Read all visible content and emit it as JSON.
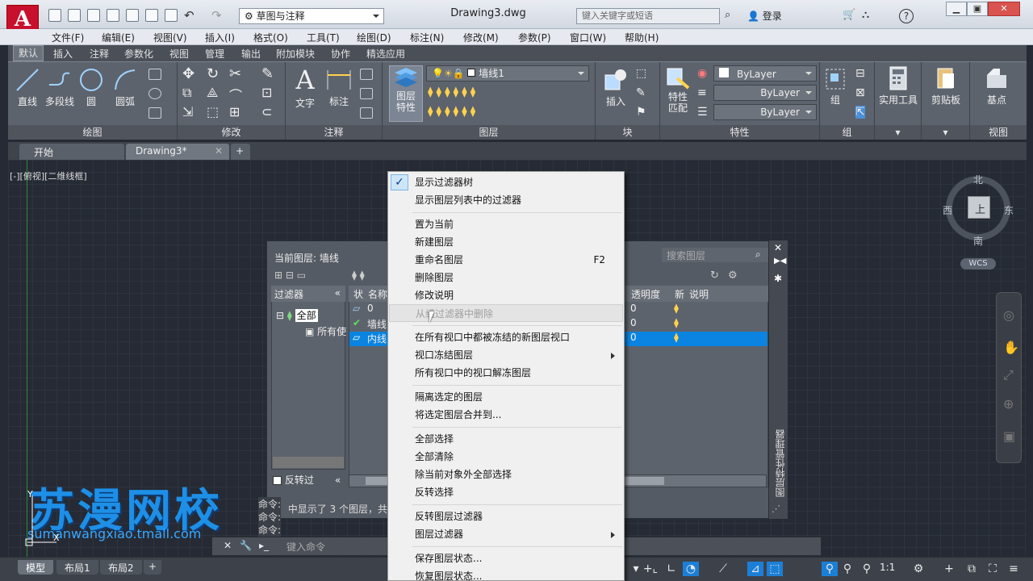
{
  "window": {
    "doc_title": "Drawing3.dwg",
    "workspace": "草图与注释",
    "search_placeholder": "键入关键字或短语",
    "sign_in": "登录"
  },
  "menubar": [
    "文件(F)",
    "编辑(E)",
    "视图(V)",
    "插入(I)",
    "格式(O)",
    "工具(T)",
    "绘图(D)",
    "标注(N)",
    "修改(M)",
    "参数(P)",
    "窗口(W)",
    "帮助(H)"
  ],
  "ribbon_tabs": [
    "默认",
    "插入",
    "注释",
    "参数化",
    "视图",
    "管理",
    "输出",
    "附加模块",
    "协作",
    "精选应用"
  ],
  "ribbon": {
    "draw": {
      "title": "绘图",
      "line": "直线",
      "polyline": "多段线",
      "circle": "圆",
      "arc": "圆弧"
    },
    "modify": {
      "title": "修改"
    },
    "annotation": {
      "title": "注释",
      "text": "文字",
      "dimension": "标注"
    },
    "layers": {
      "title": "图层",
      "properties_line1": "图层",
      "properties_line2": "特性",
      "current_layer": "墙线1"
    },
    "block": {
      "title": "块",
      "insert": "插入"
    },
    "properties": {
      "title": "特性",
      "match_line1": "特性",
      "match_line2": "匹配",
      "color": "ByLayer",
      "linetype": "ByLayer",
      "lineweight": "ByLayer"
    },
    "groups": {
      "title": "组",
      "group": "组"
    },
    "utilities": {
      "label": "实用工具"
    },
    "clipboard": {
      "label": "剪贴板"
    },
    "view": {
      "title": "视图",
      "base": "基点"
    }
  },
  "doc_tabs": [
    "开始",
    "Drawing3*"
  ],
  "viewport_label": "[-][俯视][二维线框]",
  "compass": {
    "n": "北",
    "s": "南",
    "e": "东",
    "w": "西",
    "top": "上",
    "wcs": "WCS"
  },
  "layer_palette": {
    "current_layer": "当前图层: 墙线",
    "search_placeholder": "搜索图层",
    "filters_header": "过滤器",
    "filter_all": "全部",
    "filter_used": "所有使",
    "invert_label": "反转过",
    "side_label": "图层特性管理器",
    "columns": {
      "status": "状",
      "name": "名称",
      "transparency": "透明度",
      "new": "新",
      "description": "说明"
    },
    "rows": [
      {
        "name": "0",
        "transparency": "0"
      },
      {
        "name": "墙线",
        "transparency": "0"
      },
      {
        "name": "内线",
        "transparency": "0"
      }
    ]
  },
  "command": {
    "history": [
      "命令:",
      "命令:",
      "命令:"
    ],
    "message": "列表中显示了 3 个图层，共",
    "placeholder": "键入命令"
  },
  "context_menu": [
    {
      "label": "显示过滤器树",
      "checked": true
    },
    {
      "label": "显示图层列表中的过滤器"
    },
    {
      "label": "置为当前"
    },
    {
      "label": "新建图层"
    },
    {
      "label": "重命名图层",
      "shortcut": "F2"
    },
    {
      "label": "删除图层"
    },
    {
      "label": "修改说明"
    },
    {
      "label": "从组过滤器中删除",
      "disabled": true
    },
    {
      "label": "在所有视口中都被冻结的新图层视口"
    },
    {
      "label": "视口冻结图层",
      "submenu": true
    },
    {
      "label": "所有视口中的视口解冻图层"
    },
    {
      "label": "隔离选定的图层"
    },
    {
      "label": "将选定图层合并到..."
    },
    {
      "label": "全部选择"
    },
    {
      "label": "全部清除"
    },
    {
      "label": "除当前对象外全部选择"
    },
    {
      "label": "反转选择"
    },
    {
      "label": "反转图层过滤器"
    },
    {
      "label": "图层过滤器",
      "submenu": true
    },
    {
      "label": "保存图层状态..."
    },
    {
      "label": "恢复图层状态..."
    }
  ],
  "status_tabs": [
    "模型",
    "布局1",
    "布局2"
  ],
  "status": {
    "scale": "1:1"
  },
  "watermark": {
    "title": "苏漫网校",
    "subtitle": "sumanwangxiao.tmall.com"
  },
  "colors": {
    "accent": "#1c7fd6",
    "selection": "#0a84e0",
    "logo": "#c8102e"
  }
}
